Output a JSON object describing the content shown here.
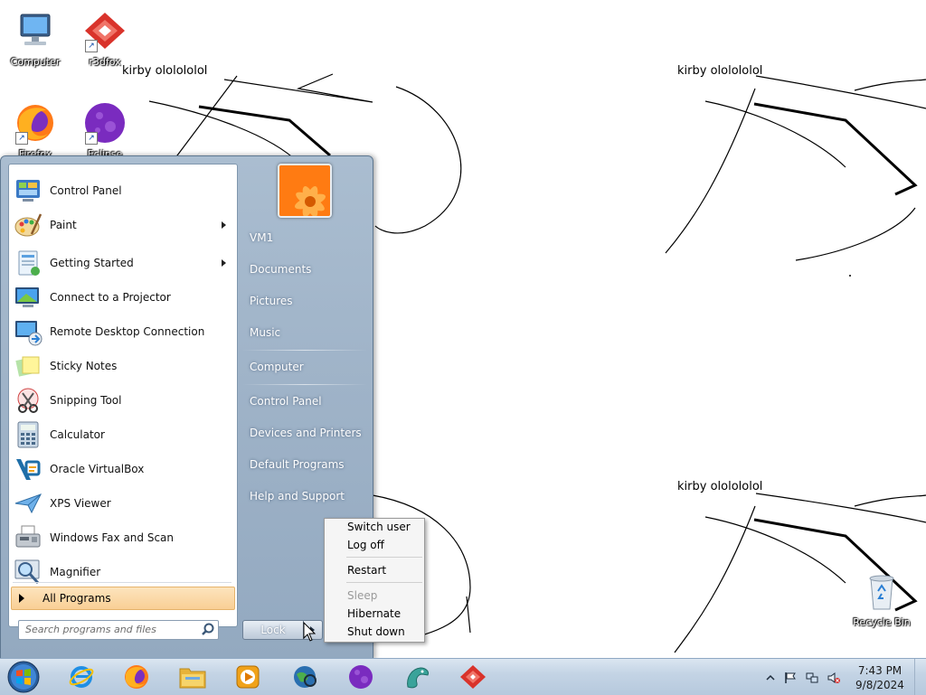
{
  "desktop": {
    "wallpaper_caption": "kirby ololololol",
    "icons": [
      {
        "label": "Computer",
        "icon": "computer-icon"
      },
      {
        "label": "r3dfox",
        "icon": "r3dfox-icon"
      },
      {
        "label": "Firefox",
        "icon": "firefox-icon"
      },
      {
        "label": "Eclipse Launch",
        "icon": "eclipse-icon"
      },
      {
        "label": "Recycle Bin",
        "icon": "recycle-bin-icon"
      }
    ]
  },
  "start_menu": {
    "programs": [
      {
        "label": "Control Panel",
        "icon": "control-panel-icon",
        "submenu": false
      },
      {
        "label": "Paint",
        "icon": "paint-icon",
        "submenu": true
      },
      {
        "label": "Getting Started",
        "icon": "getting-started-icon",
        "submenu": true
      },
      {
        "label": "Connect to a Projector",
        "icon": "projector-icon",
        "submenu": false
      },
      {
        "label": "Remote Desktop Connection",
        "icon": "remote-desktop-icon",
        "submenu": false
      },
      {
        "label": "Sticky Notes",
        "icon": "sticky-notes-icon",
        "submenu": false
      },
      {
        "label": "Snipping Tool",
        "icon": "snipping-tool-icon",
        "submenu": false
      },
      {
        "label": "Calculator",
        "icon": "calculator-icon",
        "submenu": false
      },
      {
        "label": "Oracle VirtualBox",
        "icon": "virtualbox-icon",
        "submenu": false
      },
      {
        "label": "XPS Viewer",
        "icon": "xps-viewer-icon",
        "submenu": false
      },
      {
        "label": "Windows Fax and Scan",
        "icon": "fax-scan-icon",
        "submenu": false
      },
      {
        "label": "Magnifier",
        "icon": "magnifier-icon",
        "submenu": false
      }
    ],
    "all_programs_label": "All Programs",
    "search_placeholder": "Search programs and files",
    "places": [
      {
        "label": "VM1"
      },
      {
        "label": "Documents"
      },
      {
        "label": "Pictures"
      },
      {
        "label": "Music"
      },
      {
        "label": "Computer"
      },
      {
        "label": "Control Panel"
      },
      {
        "label": "Devices and Printers"
      },
      {
        "label": "Default Programs"
      },
      {
        "label": "Help and Support"
      }
    ],
    "lock_label": "Lock",
    "power_menu": {
      "items": [
        {
          "label": "Switch user",
          "enabled": true
        },
        {
          "label": "Log off",
          "enabled": true
        },
        {
          "label": "Restart",
          "enabled": true
        },
        {
          "label": "Sleep",
          "enabled": false
        },
        {
          "label": "Hibernate",
          "enabled": true
        },
        {
          "label": "Shut down",
          "enabled": true
        }
      ]
    }
  },
  "taskbar": {
    "pinned": [
      "internet-explorer-icon",
      "firefox-icon",
      "file-explorer-icon",
      "media-player-icon",
      "network-globe-icon",
      "eclipse-icon",
      "dragon-icon",
      "r3dfox-icon"
    ],
    "clock": {
      "time": "7:43 PM",
      "date": "9/8/2024"
    }
  },
  "colors": {
    "start_menu_right": "#9fb3c8",
    "taskbar": "#c4d4e5",
    "all_programs_highlight": "#f9cf95"
  }
}
